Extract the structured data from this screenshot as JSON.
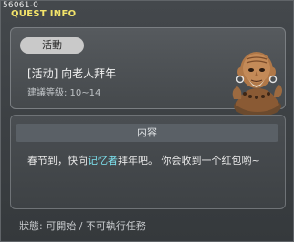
{
  "window": {
    "id": "56061-0",
    "title": "QUEST INFO"
  },
  "quest": {
    "category_badge": "活動",
    "name": "[活动] 向老人拜年",
    "level_requirement": "建議等級: 10~14",
    "npc_icon": "old-monk-npc-portrait"
  },
  "content": {
    "header": "内容",
    "text_before": "春节到，快向",
    "text_highlight": "记忆者",
    "text_after": "拜年吧。 你会收到一个红包哟~",
    "highlight_color": "#7ee3f0"
  },
  "status": {
    "text": "狀態: 可開始 / 不可執行任務"
  }
}
